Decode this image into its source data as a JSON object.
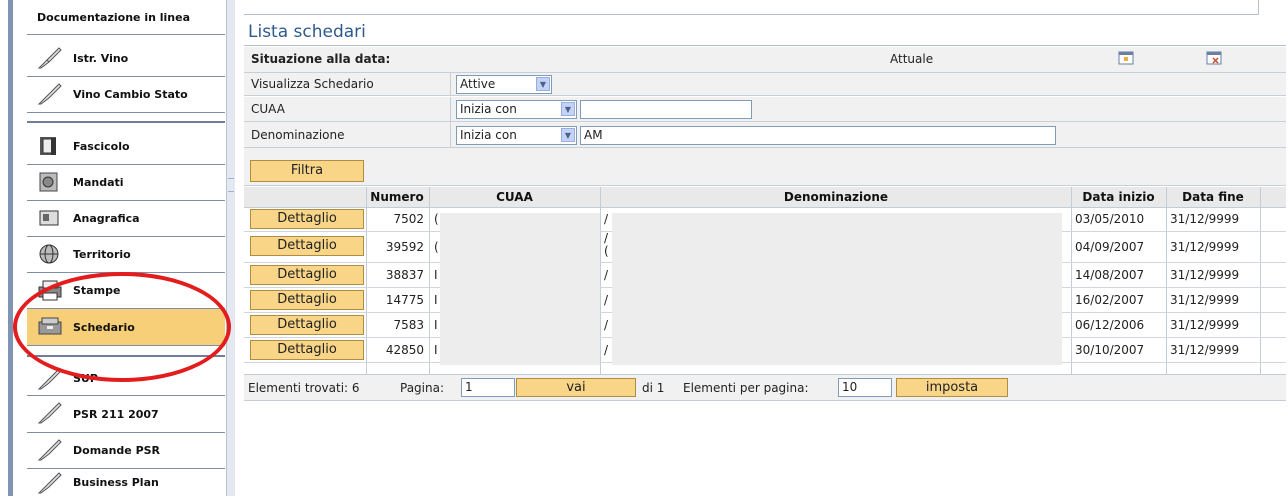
{
  "sidebar": {
    "items": [
      {
        "label": "Documentazione in linea",
        "icon": "none"
      },
      {
        "label": "Istr. Vino",
        "icon": "quill-icon"
      },
      {
        "label": "Vino Cambio Stato",
        "icon": "quill-icon"
      },
      {
        "label": "Fascicolo",
        "icon": "folder-icon"
      },
      {
        "label": "Mandati",
        "icon": "document-icon"
      },
      {
        "label": "Anagrafica",
        "icon": "id-card-icon"
      },
      {
        "label": "Territorio",
        "icon": "globe-icon"
      },
      {
        "label": "Stampe",
        "icon": "printer-icon"
      },
      {
        "label": "Schedario",
        "icon": "archive-icon",
        "selected": true
      },
      {
        "label": "SUP",
        "icon": "quill-icon"
      },
      {
        "label": "PSR 211 2007",
        "icon": "quill-icon"
      },
      {
        "label": "Domande PSR",
        "icon": "quill-icon"
      },
      {
        "label": "Business Plan",
        "icon": "quill-icon"
      }
    ]
  },
  "main": {
    "title": "Lista schedari",
    "situazione": {
      "label": "Situazione alla data:",
      "value": "Attuale"
    },
    "filters": {
      "visualizza": {
        "label": "Visualizza Schedario",
        "selected": "Attive"
      },
      "cuaa": {
        "label": "CUAA",
        "mode": "Inizia con",
        "value": ""
      },
      "denominazione": {
        "label": "Denominazione",
        "mode": "Inizia con",
        "value": "AM"
      },
      "filtra_label": "Filtra"
    },
    "table": {
      "headers": [
        "Numero",
        "CUAA",
        "Denominazione",
        "Data inizio",
        "Data fine"
      ],
      "detail_label": "Dettaglio",
      "rows": [
        {
          "numero": "7502",
          "cuaa": "(",
          "den": "/",
          "den2": "",
          "inizio": "03/05/2010",
          "fine": "31/12/9999"
        },
        {
          "numero": "39592",
          "cuaa": "(",
          "den": "/",
          "den2": "(",
          "inizio": "04/09/2007",
          "fine": "31/12/9999"
        },
        {
          "numero": "38837",
          "cuaa": "I",
          "den": "/",
          "den2": "",
          "inizio": "14/08/2007",
          "fine": "31/12/9999"
        },
        {
          "numero": "14775",
          "cuaa": "I",
          "den": "/",
          "den2": "",
          "inizio": "16/02/2007",
          "fine": "31/12/9999"
        },
        {
          "numero": "7583",
          "cuaa": "I",
          "den": "/",
          "den2": "",
          "inizio": "06/12/2006",
          "fine": "31/12/9999"
        },
        {
          "numero": "42850",
          "cuaa": "I",
          "den": "/",
          "den2": "",
          "inizio": "30/10/2007",
          "fine": "31/12/9999"
        }
      ]
    },
    "footer": {
      "found_label": "Elementi trovati: 6",
      "page_label": "Pagina:",
      "page_value": "1",
      "go_label": "vai",
      "of_label": "di 1",
      "per_page_label": "Elementi per pagina:",
      "per_page_value": "10",
      "set_label": "imposta"
    }
  },
  "colors": {
    "accent": "#f9d587",
    "title": "#2e5a8c",
    "highlight_ellipse": "#e31d1d"
  }
}
